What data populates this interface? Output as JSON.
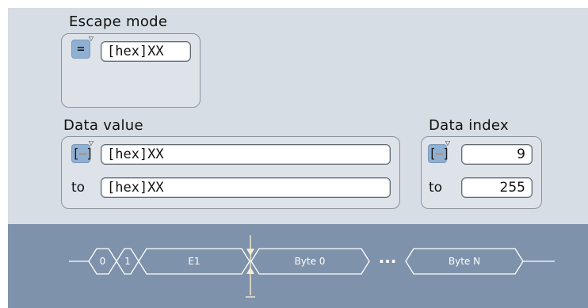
{
  "escape_mode": {
    "label": "Escape mode",
    "operator": "=",
    "value": "[hex]XX"
  },
  "data_value": {
    "label": "Data value",
    "operator": "[–]",
    "from_value": "[hex]XX",
    "to_label": "to",
    "to_value": "[hex]XX"
  },
  "data_index": {
    "label": "Data index",
    "operator": "[–]",
    "from_value": "9",
    "to_label": "to",
    "to_value": "255"
  },
  "frame_diagram": {
    "fields": [
      "0",
      "1",
      "E1",
      "Byte 0",
      "Byte N"
    ],
    "ellipsis": "···"
  },
  "colors": {
    "panel_bg": "#d6dde4",
    "button_blue": "#8fb0d3",
    "range_dash": "#e0701e",
    "diagram_bg": "#7f92ab"
  }
}
